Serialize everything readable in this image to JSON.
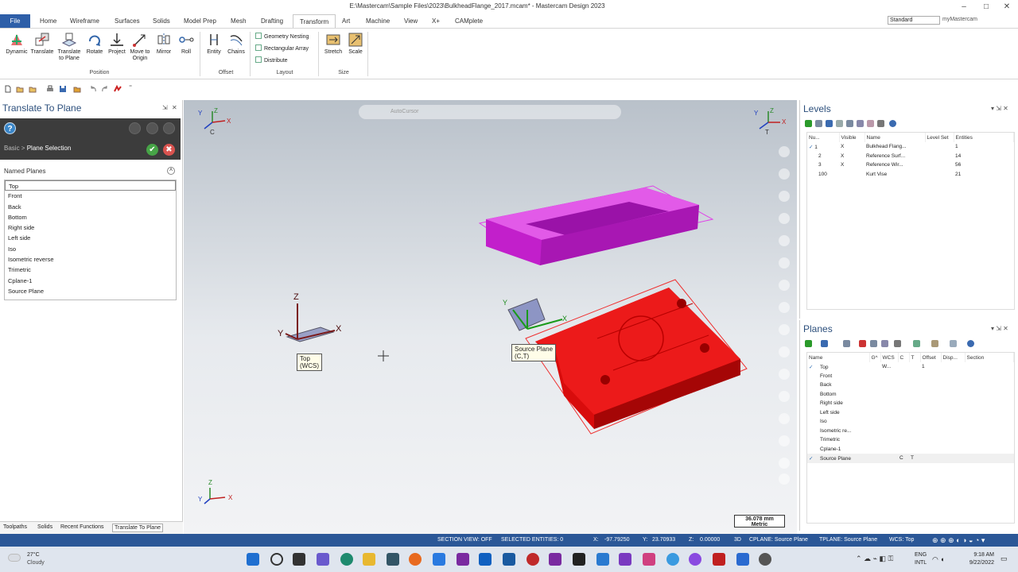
{
  "window": {
    "title": "E:\\Mastercam\\Sample Files\\2023\\BulkheadFlange_2017.mcam* - Mastercam Design 2023",
    "min": "–",
    "max": "□",
    "close": "✕"
  },
  "ribbon_tabs": [
    "File",
    "Home",
    "Wireframe",
    "Surfaces",
    "Solids",
    "Model Prep",
    "Mesh",
    "Drafting",
    "Transform",
    "Art",
    "Machine",
    "View",
    "X+",
    "CAMplete"
  ],
  "active_tab": "Transform",
  "workspace_select": "Standard",
  "my_mastercam": "myMastercam",
  "ribbon": {
    "position_buttons": [
      {
        "label": "Dynamic",
        "icon": "dynamic-icon"
      },
      {
        "label": "Translate",
        "icon": "translate-icon"
      },
      {
        "label": "Translate to Plane",
        "icon": "translate-to-plane-icon"
      },
      {
        "label": "Rotate",
        "icon": "rotate-icon"
      },
      {
        "label": "Project",
        "icon": "project-icon"
      },
      {
        "label": "Move to Origin",
        "icon": "move-to-origin-icon"
      },
      {
        "label": "Mirror",
        "icon": "mirror-icon"
      },
      {
        "label": "Roll",
        "icon": "roll-icon"
      }
    ],
    "offset_buttons": [
      {
        "label": "Entity",
        "icon": "offset-entity-icon"
      },
      {
        "label": "Chains",
        "icon": "offset-chains-icon"
      }
    ],
    "layout_buttons": [
      "Geometry Nesting",
      "Rectangular Array",
      "Distribute"
    ],
    "size_buttons": [
      {
        "label": "Stretch",
        "icon": "stretch-icon"
      },
      {
        "label": "Scale",
        "icon": "scale-icon"
      }
    ],
    "groups": {
      "position": "Position",
      "offset": "Offset",
      "layout": "Layout",
      "size": "Size"
    }
  },
  "left_panel": {
    "title": "Translate To Plane",
    "pin": "⇲",
    "close": "✕",
    "help": "?",
    "breadcrumb_root": "Basic",
    "breadcrumb_sep": ">",
    "breadcrumb_current": "Plane Selection",
    "ok": "✔",
    "cancel": "✖",
    "named_planes_label": "Named Planes",
    "collapse": "˄",
    "named_planes": [
      "Top",
      "Front",
      "Back",
      "Bottom",
      "Right side",
      "Left side",
      "Iso",
      "Isometric reverse",
      "Trimetric",
      "Cplane-1",
      "Source Plane"
    ],
    "selected_plane": "Top"
  },
  "bottom_tabs": [
    "Toolpaths",
    "Solids",
    "Recent Functions",
    "Translate To Plane"
  ],
  "active_bottom_tab": "Translate To Plane",
  "viewport": {
    "autocursor": "AutoCursor",
    "top_left_indicator": "C",
    "top_right_indicator": "T",
    "top_tag_line1": "Top",
    "top_tag_line2": "(WCS)",
    "source_tag_line1": "Source Plane",
    "source_tag_line2": "(C,T)",
    "scale_value": "36.078 mm",
    "scale_units": "Metric",
    "axis_x": "X",
    "axis_y": "Y",
    "axis_z": "Z"
  },
  "levels": {
    "title": "Levels",
    "headers": [
      "Nu...",
      "Visible",
      "Name",
      "Level Set",
      "Entities"
    ],
    "rows": [
      {
        "check": "✓",
        "num": "1",
        "visible": "X",
        "name": "Bulkhead Flang...",
        "set": "",
        "entities": "1"
      },
      {
        "check": "",
        "num": "2",
        "visible": "X",
        "name": "Reference Surf...",
        "set": "",
        "entities": "14"
      },
      {
        "check": "",
        "num": "3",
        "visible": "X",
        "name": "Reference Wir...",
        "set": "",
        "entities": "56"
      },
      {
        "check": "",
        "num": "100",
        "visible": "",
        "name": "Kurt Vise",
        "set": "",
        "entities": "21"
      }
    ]
  },
  "planes": {
    "title": "Planes",
    "headers": [
      "Name",
      "G^",
      "WCS",
      "C",
      "T",
      "Offset",
      "Disp...",
      "Section"
    ],
    "rows": [
      {
        "check": "✓",
        "name": "Top",
        "wcs": "W...",
        "c": "",
        "t": "",
        "offset": "1"
      },
      {
        "check": "",
        "name": "Front",
        "wcs": "",
        "c": "",
        "t": "",
        "offset": ""
      },
      {
        "check": "",
        "name": "Back",
        "wcs": "",
        "c": "",
        "t": "",
        "offset": ""
      },
      {
        "check": "",
        "name": "Bottom",
        "wcs": "",
        "c": "",
        "t": "",
        "offset": ""
      },
      {
        "check": "",
        "name": "Right side",
        "wcs": "",
        "c": "",
        "t": "",
        "offset": ""
      },
      {
        "check": "",
        "name": "Left side",
        "wcs": "",
        "c": "",
        "t": "",
        "offset": ""
      },
      {
        "check": "",
        "name": "Iso",
        "wcs": "",
        "c": "",
        "t": "",
        "offset": ""
      },
      {
        "check": "",
        "name": "Isometric re...",
        "wcs": "",
        "c": "",
        "t": "",
        "offset": ""
      },
      {
        "check": "",
        "name": "Trimetric",
        "wcs": "",
        "c": "",
        "t": "",
        "offset": ""
      },
      {
        "check": "",
        "name": "Cplane-1",
        "wcs": "",
        "c": "",
        "t": "",
        "offset": ""
      },
      {
        "check": "✓",
        "name": "Source Plane",
        "wcs": "",
        "c": "C",
        "t": "T",
        "offset": ""
      }
    ]
  },
  "statusbar": {
    "section_view": "SECTION VIEW: OFF",
    "selected": "SELECTED ENTITIES: 0",
    "x_label": "X:",
    "x": "-97.79250",
    "y_label": "Y:",
    "y": "23.70933",
    "z_label": "Z:",
    "z": "0.00000",
    "mode": "3D",
    "cplane": "CPLANE: Source Plane",
    "tplane": "TPLANE: Source Plane",
    "wcs": "WCS: Top"
  },
  "taskbar": {
    "temp": "27°C",
    "weather": "Cloudy",
    "lang1": "ENG",
    "lang2": "INTL",
    "time": "9:18 AM",
    "date": "9/22/2022"
  },
  "colors": {
    "accent": "#2b5797",
    "part_magenta": "#d82ee0",
    "part_red": "#e01010",
    "ok": "#47a447",
    "cancel": "#d9534f"
  }
}
